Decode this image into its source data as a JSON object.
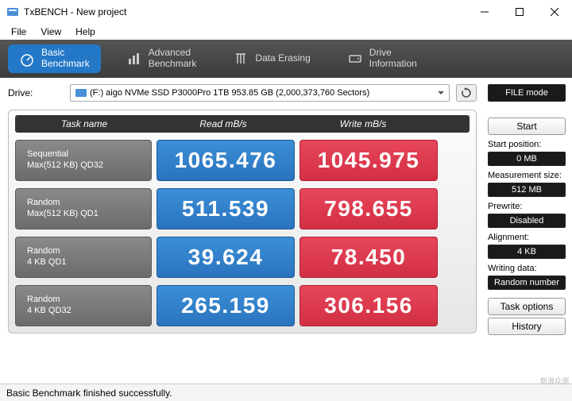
{
  "window": {
    "title": "TxBENCH - New project"
  },
  "menu": {
    "file": "File",
    "view": "View",
    "help": "Help"
  },
  "tabs": {
    "basic": "Basic\nBenchmark",
    "advanced": "Advanced\nBenchmark",
    "erase": "Data Erasing",
    "driveinfo": "Drive\nInformation"
  },
  "drive": {
    "label": "Drive:",
    "selected": "(F:) aigo NVMe SSD P3000Pro 1TB  953.85 GB (2,000,373,760 Sectors)"
  },
  "filemode_btn": "FILE mode",
  "headers": {
    "task": "Task name",
    "read": "Read mB/s",
    "write": "Write mB/s"
  },
  "rows": [
    {
      "name1": "Sequential",
      "name2": "Max(512 KB) QD32",
      "read": "1065.476",
      "write": "1045.975"
    },
    {
      "name1": "Random",
      "name2": "Max(512 KB) QD1",
      "read": "511.539",
      "write": "798.655"
    },
    {
      "name1": "Random",
      "name2": "4 KB QD1",
      "read": "39.624",
      "write": "78.450"
    },
    {
      "name1": "Random",
      "name2": "4 KB QD32",
      "read": "265.159",
      "write": "306.156"
    }
  ],
  "side": {
    "start": "Start",
    "start_pos_label": "Start position:",
    "start_pos_val": "0 MB",
    "meas_label": "Measurement size:",
    "meas_val": "512 MB",
    "prewrite_label": "Prewrite:",
    "prewrite_val": "Disabled",
    "align_label": "Alignment:",
    "align_val": "4 KB",
    "wdata_label": "Writing data:",
    "wdata_val": "Random number",
    "taskopt": "Task options",
    "history": "History"
  },
  "status": "Basic Benchmark finished successfully.",
  "watermark": "新浪众测"
}
